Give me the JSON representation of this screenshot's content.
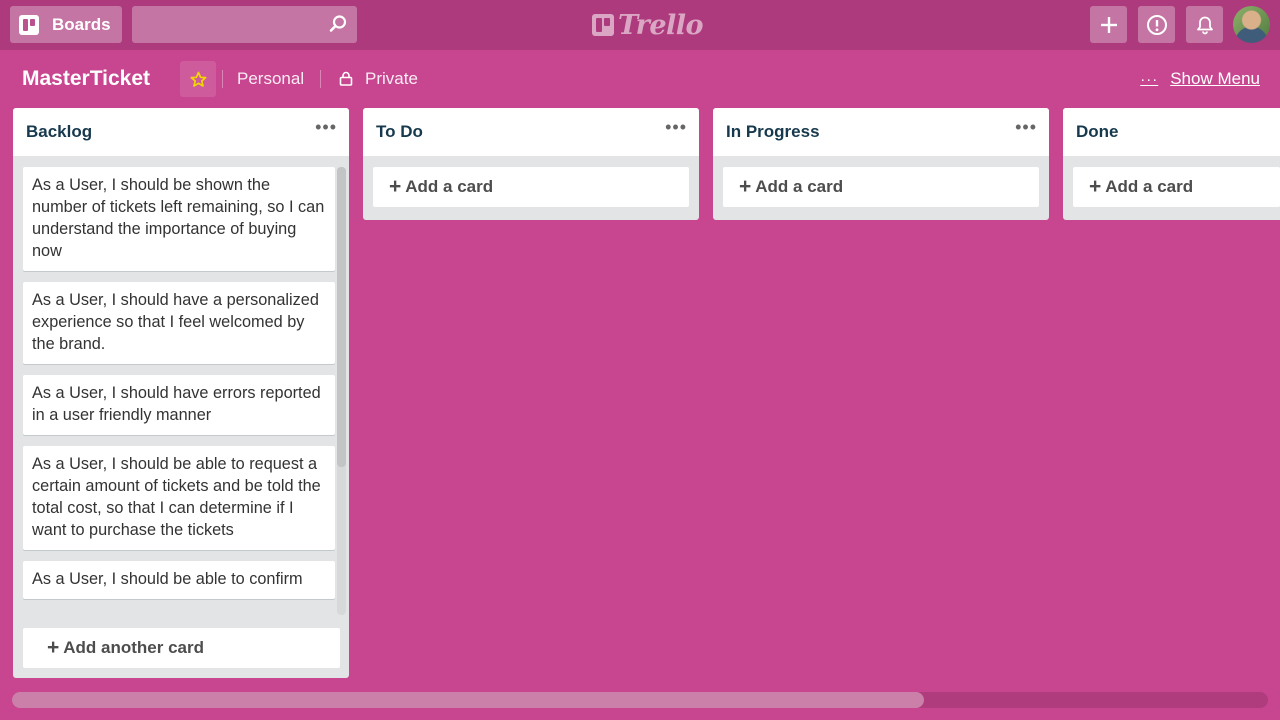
{
  "header": {
    "boards_label": "Boards",
    "search_placeholder": "",
    "logo_text": "Trello"
  },
  "board": {
    "title": "MasterTicket",
    "team": "Personal",
    "visibility": "Private",
    "show_menu": "Show Menu",
    "starred_color": "#f2d600"
  },
  "lists": [
    {
      "name": "Backlog",
      "cards": [
        "As a User, I should be shown the number of tickets left remaining, so I can understand the importance of buying now",
        "As a User, I should have a personalized experience so that I feel welcomed by the brand.",
        "As a User, I should have errors reported in a user friendly manner",
        "As a User, I should be able to request a certain amount of tickets and be told the total cost, so that I can determine if I want to purchase the tickets",
        "As a User, I should be able to confirm"
      ],
      "add_label": "Add another card"
    },
    {
      "name": "To Do",
      "add_label": "Add a card"
    },
    {
      "name": "In Progress",
      "add_label": "Add a card"
    },
    {
      "name": "Done",
      "add_label": "Add a card"
    }
  ],
  "colors": {
    "background": "#c8458f",
    "header": "#ad3a7c"
  }
}
